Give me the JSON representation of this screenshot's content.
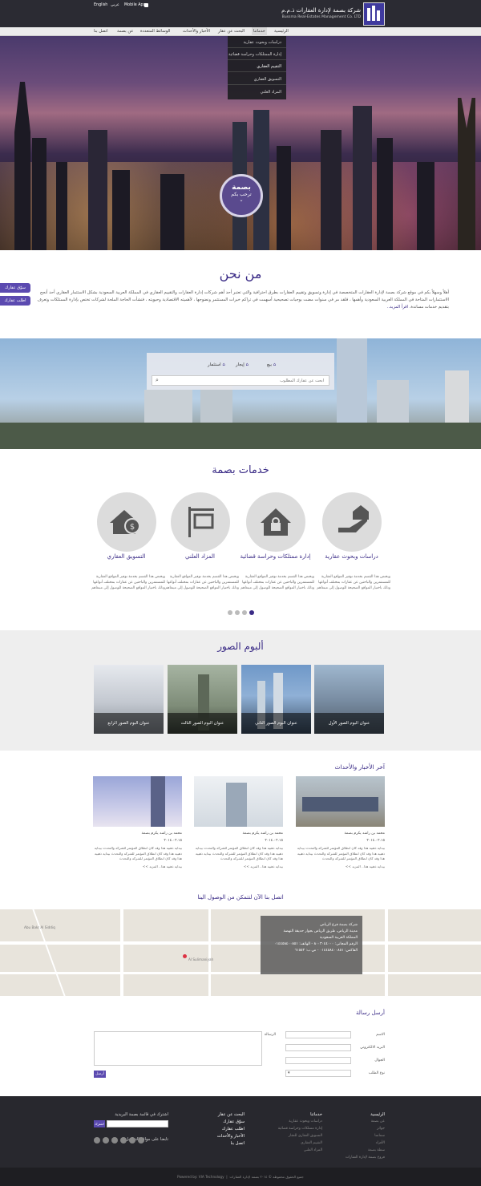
{
  "topbar": {
    "company_ar": "شركة بصمة لإدارة العقارات ذ.م.م",
    "company_en": "Bussma Real-Estates Management Co. LTD",
    "lang_en": "English",
    "lang_ar": "عربي",
    "mobile_app": "Mobile App"
  },
  "menu": {
    "items": [
      "الرئيسية",
      "خدماتنا",
      "البحث عن عقار",
      "الأخبار والأحداث",
      "الوسائط المتعددة",
      "عن بصمة",
      "اتصل بنا"
    ]
  },
  "submenu": {
    "items": [
      "دراسات وبحوث عقارية",
      "إدارة الممتلكات وحراسة قضائية",
      "التقييم العقاري",
      "التسويق العقاري",
      "المزاد العلني"
    ]
  },
  "hero": {
    "badge_logo": "بصمة",
    "badge_text": "ترحب بكم",
    "colors": {
      "sky_top": "#4a3a6c",
      "glow": "#a06a82"
    }
  },
  "side_buttons": {
    "market": "سوّق عقارك",
    "request": "اطلب عقارك"
  },
  "about": {
    "title": "من نحن",
    "text": "أهلاً وسهلاً بكم في موقع شركة بصمة لإدارة العقارات المتخصصة في إدارة وتسويق وتقييم العقارات بطرق احترافية والتي تعتبر أحد أهم شركات إدارة العقارات والتقييم العقاري في المملكة العربية السعودية بشكل الاستثمار العقاري أحد أنجح الاستثمارات المتاحة في المملكة العربية السعودية وأهمها ، فلقد مر في سنوات مضت بوجبات تصحيحية أسهمت في تراكم خبرات المستثمر ونضوجها ، لأهميته الاقتصادية وحيويته ، فنشأت الحاجة الملحة لشركات تختص بإدارة الممتلكات وتعرف بتقديم خدمات مساندة.",
    "more": "اقرأ المزيد.."
  },
  "search": {
    "tabs": [
      "بيع",
      "إيجار",
      "استثمار"
    ],
    "placeholder": "ابحث عن عقارك المطلوب"
  },
  "services": {
    "title": "خدمات بصمة",
    "items": [
      {
        "title": "دراسات وبحوث عقارية",
        "icon": "hand-house-icon",
        "text": "ويختص هذا القسم بخدمة توفير المواقع العقارية للمستثمرين والباحثين عن عقارات بمختلف أنواعها وذلك باختيار المواقع الصحيحة للوصول إلى مبتغاهم"
      },
      {
        "title": "إدارة ممتلكات وحراسة قضائية",
        "icon": "house-lock-icon",
        "text": "ويختص هذا القسم بخدمة توفير المواقع العقارية للمستثمرين والباحثين عن عقارات بمختلف أنواعها وذلك باختيار المواقع الصحيحة للوصول إلى مبتغاهم"
      },
      {
        "title": "المزاد العلني",
        "icon": "auction-sign-icon",
        "text": "ويختص هذا القسم بخدمة توفير المواقع العقارية للمستثمرين والباحثين عن عقارات بمختلف أنواعها وذلك باختيار المواقع الصحيحة للوصول إلى مبتغاهم"
      },
      {
        "title": "التسويق العقاري",
        "icon": "house-coin-icon",
        "text": "ويختص هذا القسم بخدمة توفير المواقع العقارية للمستثمرين والباحثين عن عقارات بمختلف أنواعها وذلك باختيار المواقع الصحيحة للوصول إلى مبتغاهم"
      }
    ]
  },
  "gallery": {
    "title": "ألبوم الصور",
    "albums": [
      "عنوان البوم الصور الأول",
      "عنوان البوم الصور الثاني",
      "عنوان البوم الصور الثالث",
      "عنوان البوم الصور الرابع"
    ]
  },
  "news": {
    "title": "آخر الأخبار والأحداث",
    "items": [
      {
        "headline": "محمد بن راشد يكرم بصمة",
        "date": "٢٠١٤.٠٢.١٥",
        "body": "بيداية ذهبية هذا وقد كان انطلاق المؤتمر للشركة والتحدث بيداية ذهبية هذا وقد كان انطلاق المؤتمر للشركة والتحدث بيداية ذهبية هذا وقد كان انطلاق المؤتمر للشركة والتحدث",
        "more": "بيداية ذهبية هذا.. المزيد >>"
      },
      {
        "headline": "محمد بن راشد يكرم بصمة",
        "date": "٢٠١٤.٠٢.١٥",
        "body": "بيداية ذهبية هذا وقد كان انطلاق المؤتمر للشركة والتحدث بيداية ذهبية هذا وقد كان انطلاق المؤتمر للشركة والتحدث بيداية ذهبية هذا وقد كان انطلاق المؤتمر للشركة والتحدث",
        "more": "بيداية ذهبية هذا.. المزيد >>"
      },
      {
        "headline": "محمد بن راشد يكرم بصمة",
        "date": "٢٠١٤.٠٢.١٥",
        "body": "بيداية ذهبية هذا وقد كان انطلاق المؤتمر للشركة والتحدث بيداية ذهبية هذا وقد كان انطلاق المؤتمر للشركة والتحدث بيداية ذهبية هذا وقد كان انطلاق المؤتمر للشركة والتحدث",
        "more": "بيداية ذهبية هذا.. المزيد >>"
      }
    ]
  },
  "contact": {
    "title": "اتصل بنا الآن لتتمكن من الوصول الينا",
    "card_lines": [
      "شركة بصمة فرع الرياض",
      "مدينة الرياض، طريق الرياض بجوار حديقة النهضة",
      "المملكة العربية السعودية",
      "الرقم المجاني: ٨٠٠٣٠٤٤٠٠٠ - الهاتف: ٠١٤٤٥٨٤٠٠٨٥١",
      "الفاكس: ٠١٤٤٥٨٤٠٠٨٥١ - ص.ب: ٦١٥٥٣"
    ],
    "map_labels": [
      "Abu Bakr Al Siddiq",
      "Al Sulimaniyah"
    ]
  },
  "form": {
    "title": "أرسل رسالة",
    "name_label": "الاسم",
    "email_label": "البريد الالكتروني",
    "mobile_label": "الجوال",
    "type_label": "نوع الطلب",
    "message_label": "الرسالة",
    "send": "أرسل"
  },
  "footer": {
    "col1": {
      "head": "الرئيسية",
      "links": [
        "عن بصمة",
        "جوائز",
        "سمانتنا",
        "الأفراد",
        "سطة بصمة",
        "فروع بصمة لإدارة العقارات"
      ]
    },
    "col2": {
      "head": "خدماتنا",
      "links": [
        "دراسات وبحوث عقارية",
        "إدارة ممتلكات وحراسة قضائية",
        "التسويق العقاري للعقار",
        "التقييم العقاري",
        "المزاد العلني"
      ]
    },
    "col3": {
      "links": [
        "البحث عن عقار",
        "سوّق عقارك",
        "اطلب عقارك",
        "الأخبار والأحداث",
        "اتصل بنا"
      ]
    },
    "newsletter": "اشترك في قائمة بصمة البريدية",
    "subscribe": "اشترك",
    "follow": "تابعنا على مواقع التواصل",
    "social_icons": [
      "facebook-icon",
      "twitter-icon",
      "youtube-icon",
      "linkedin-icon",
      "instagram-icon",
      "googleplus-icon"
    ]
  },
  "bottombar": {
    "copyright": "جميع الحقوق محفوظة © ٢٠١٤ بصمة لإدارة العقارات",
    "powered": "Powered by: VIA Technology"
  }
}
